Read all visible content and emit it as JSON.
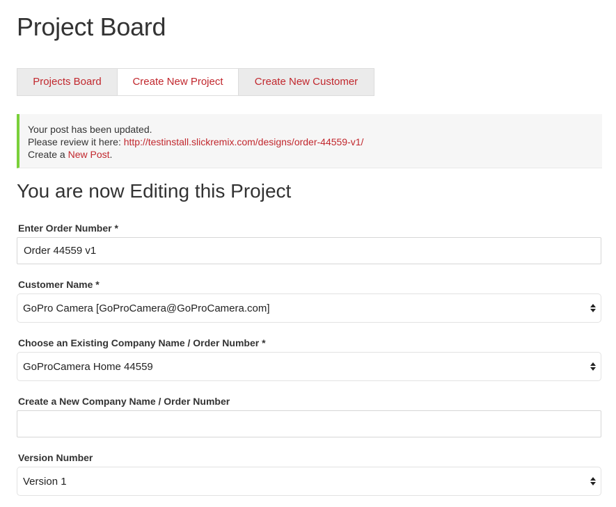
{
  "page": {
    "title": "Project Board"
  },
  "tabs": [
    {
      "label": "Projects Board",
      "active": false
    },
    {
      "label": "Create New Project",
      "active": true
    },
    {
      "label": "Create New Customer",
      "active": false
    }
  ],
  "notice": {
    "line1": "Your post has been updated.",
    "line2_prefix": "Please review it here: ",
    "line2_link": "http://testinstall.slickremix.com/designs/order-44559-v1/",
    "line3_prefix": "Create a ",
    "line3_link": "New Post",
    "line3_suffix": ".",
    "accent_color": "#7ad03a",
    "link_color": "#c1272d"
  },
  "section": {
    "title": "You are now Editing this Project"
  },
  "form": {
    "order_number": {
      "label": "Enter Order Number *",
      "value": "Order 44559 v1"
    },
    "customer_name": {
      "label": "Customer Name *",
      "selected": "GoPro Camera [GoProCamera@GoProCamera.com]"
    },
    "existing_company": {
      "label": "Choose an Existing Company Name / Order Number *",
      "selected": "GoProCamera Home 44559"
    },
    "new_company": {
      "label": "Create a New Company Name / Order Number",
      "value": ""
    },
    "version_number": {
      "label": "Version Number",
      "selected": "Version 1"
    }
  },
  "icons": {
    "select_arrows": "up-down-arrows-icon"
  }
}
